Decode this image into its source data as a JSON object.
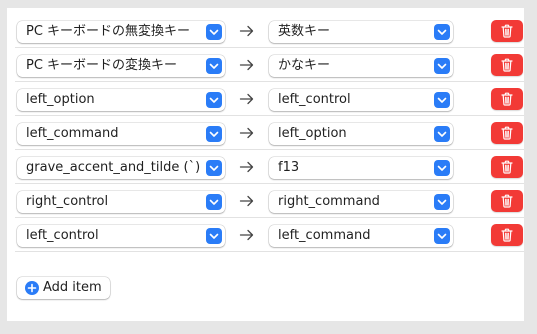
{
  "colors": {
    "accent": "#2a7cf7",
    "delete": "#f23a36",
    "background": "#e6e6e6",
    "panel": "#ffffff"
  },
  "icons": {
    "arrow": "right-arrow-icon",
    "stepper": "chevron-down-icon",
    "delete": "trash-icon",
    "add": "plus-circle-icon"
  },
  "mappings": [
    {
      "from": "PC キーボードの無変換キー",
      "to": "英数キー"
    },
    {
      "from": "PC キーボードの変換キー",
      "to": "かなキー"
    },
    {
      "from": "left_option",
      "to": "left_control"
    },
    {
      "from": "left_command",
      "to": "left_option"
    },
    {
      "from": "grave_accent_and_tilde (`)",
      "to": "f13"
    },
    {
      "from": "right_control",
      "to": "right_command"
    },
    {
      "from": "left_control",
      "to": "left_command"
    }
  ],
  "add_button": {
    "label": "Add item"
  }
}
